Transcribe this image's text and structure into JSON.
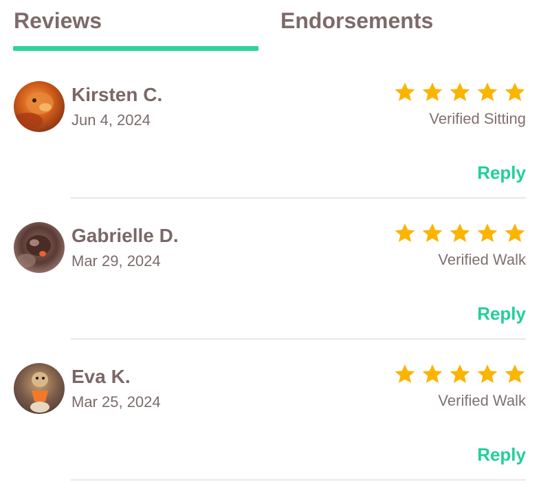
{
  "tabs": [
    {
      "label": "Reviews",
      "active": true
    },
    {
      "label": "Endorsements",
      "active": false
    }
  ],
  "colors": {
    "accent": "#2ed39a",
    "reply": "#22cf9a",
    "star": "#fbb400",
    "text": "#7b6767"
  },
  "reviews": [
    {
      "name": "Kirsten C.",
      "date": "Jun 4, 2024",
      "rating": 5,
      "verified": "Verified Sitting",
      "reply_label": "Reply",
      "avatar_icon": "dog-photo-avatar"
    },
    {
      "name": "Gabrielle D.",
      "date": "Mar 29, 2024",
      "rating": 5,
      "verified": "Verified Walk",
      "reply_label": "Reply",
      "avatar_icon": "dog-photo-avatar"
    },
    {
      "name": "Eva K.",
      "date": "Mar 25, 2024",
      "rating": 5,
      "verified": "Verified Walk",
      "reply_label": "Reply",
      "avatar_icon": "dog-photo-avatar"
    }
  ]
}
